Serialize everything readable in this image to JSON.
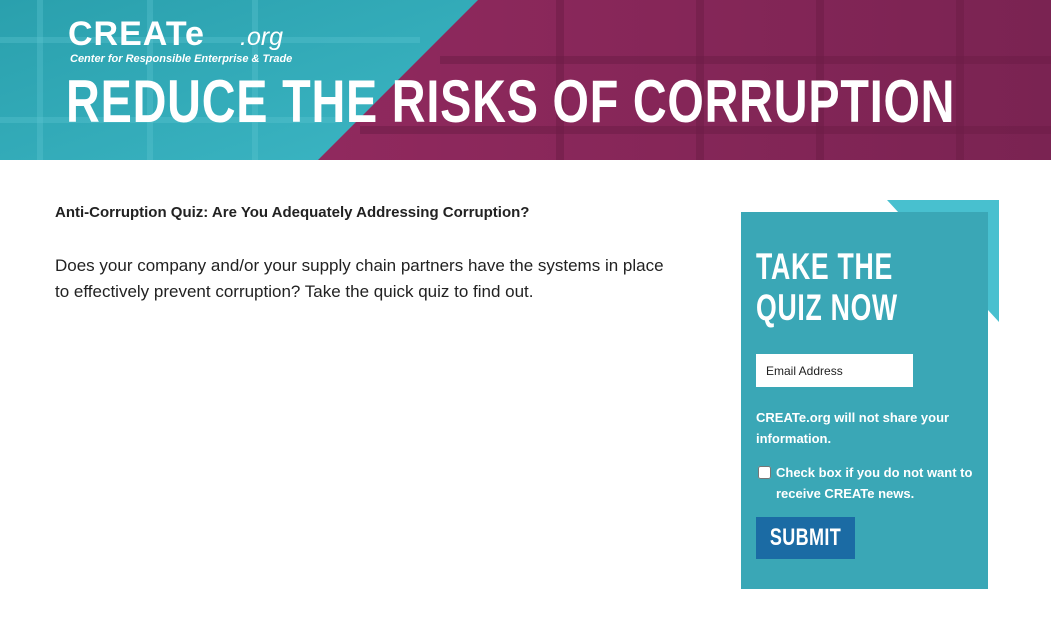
{
  "header": {
    "logo_word": "CREATe",
    "logo_suffix": ".org",
    "logo_tagline": "Center for Responsible Enterprise & Trade",
    "title": "REDUCE THE RISKS OF CORRUPTION"
  },
  "main": {
    "heading": "Anti-Corruption Quiz: Are You Adequately Addressing Corruption?",
    "intro": "Does your company and/or your supply chain partners have the systems in place to effectively prevent corruption? Take the quick quiz to find out."
  },
  "quiz_panel": {
    "title": "TAKE THE QUIZ NOW",
    "email_placeholder": "Email Address",
    "privacy_note": "CREATe.org will not share your information.",
    "checkbox_label": "Check box if you do not want to receive CREATe news.",
    "checkbox_checked": false,
    "submit_label": "SUBMIT"
  },
  "colors": {
    "teal": "#3aa7b6",
    "magenta": "#8e2a5f",
    "submit_blue": "#1b6ba4"
  }
}
